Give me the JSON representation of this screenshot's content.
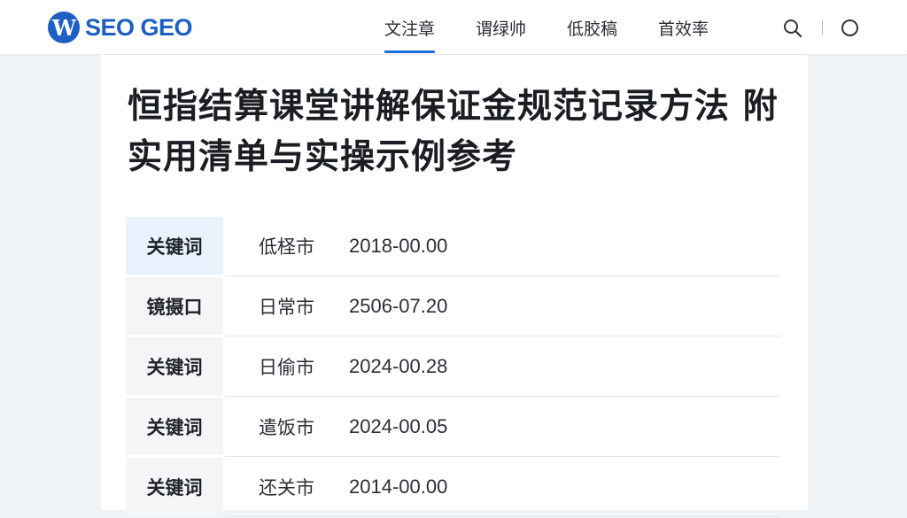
{
  "header": {
    "logo_mark": "W",
    "logo_text": "SEO GEO",
    "nav": [
      {
        "label": "文注章",
        "active": true
      },
      {
        "label": "谓绿帅",
        "active": false
      },
      {
        "label": "低胶稿",
        "active": false
      },
      {
        "label": "首效率",
        "active": false
      }
    ],
    "icons": [
      "search-icon",
      "circle-icon"
    ],
    "accent_color": "#1d6fd9"
  },
  "article": {
    "title": "恒指结算课堂讲解保证金规范记录方法 附实用清单与实操示例参考",
    "rows": [
      {
        "key": "关键词",
        "city": "低柽市",
        "date": "2018-00.00",
        "highlight": true
      },
      {
        "key": "镜摄口",
        "city": "日常市",
        "date": "2506-07.20",
        "highlight": false
      },
      {
        "key": "关键词",
        "city": "日偷市",
        "date": "2024-00.28",
        "highlight": false
      },
      {
        "key": "关键词",
        "city": "遣饭市",
        "date": "2024-00.05",
        "highlight": false
      },
      {
        "key": "关键词",
        "city": "还关市",
        "date": "2014-00.00",
        "highlight": false
      }
    ]
  }
}
